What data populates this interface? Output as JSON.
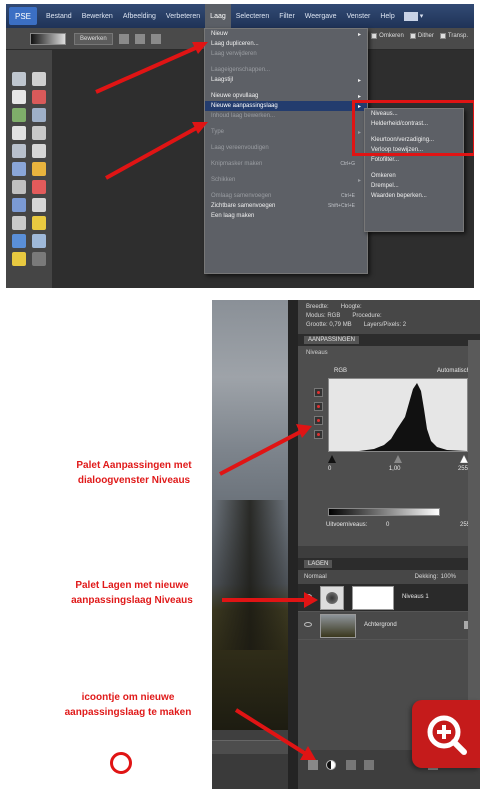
{
  "top_screenshot": {
    "menubar": {
      "logo": "PSE",
      "items": [
        "Bestand",
        "Bewerken",
        "Afbeelding",
        "Verbeteren",
        "Laag",
        "Selecteren",
        "Filter",
        "Weergave",
        "Venster",
        "Help"
      ],
      "active_item": "Laag"
    },
    "options_bar": {
      "button_label": "Bewerken",
      "checkboxes": [
        "Omkeren",
        "Dither",
        "Transp."
      ]
    },
    "layer_menu": [
      {
        "label": "Nieuw",
        "dim": false,
        "arrow": true
      },
      {
        "label": "Laag dupliceren...",
        "dim": false
      },
      {
        "label": "Laag verwijderen",
        "dim": true
      },
      {
        "sep": true
      },
      {
        "label": "Laageigenschappen...",
        "dim": true
      },
      {
        "label": "Laagstijl",
        "dim": false,
        "arrow": true
      },
      {
        "sep": true
      },
      {
        "label": "Nieuwe opvullaag",
        "dim": false,
        "arrow": true
      },
      {
        "label": "Nieuwe aanpassingslaag",
        "highlight": true,
        "arrow": true
      },
      {
        "label": "Inhoud laag bewerken...",
        "dim": true
      },
      {
        "sep": true
      },
      {
        "label": "Type",
        "dim": true,
        "arrow": true
      },
      {
        "sep": true
      },
      {
        "label": "Laag vereenvoudigen",
        "dim": true
      },
      {
        "sep": true
      },
      {
        "label": "Knipmasker maken",
        "dim": true,
        "shortcut": "Ctrl+G"
      },
      {
        "sep": true
      },
      {
        "label": "Schikken",
        "dim": true,
        "arrow": true
      },
      {
        "sep": true
      },
      {
        "label": "Omlaag samenvoegen",
        "dim": true,
        "shortcut": "Ctrl+E"
      },
      {
        "label": "Zichtbare samenvoegen",
        "dim": false,
        "shortcut": "Shift+Ctrl+E"
      },
      {
        "label": "Een laag maken",
        "dim": false
      }
    ],
    "sub_menu": [
      {
        "label": "Niveaus...",
        "highlight": false
      },
      {
        "label": "Helderheid/contrast...",
        "highlight": false
      },
      {
        "label": "Kleurtoon/verzadiging...",
        "highlight": false
      },
      {
        "label": "Verloop toewijzen...",
        "highlight": false
      },
      {
        "label": "Fotofilter...",
        "highlight": false
      },
      {
        "label": "Omkeren",
        "highlight": false
      },
      {
        "label": "Drempel...",
        "highlight": false
      },
      {
        "label": "Waarden beperken...",
        "highlight": false
      }
    ]
  },
  "bottom_screenshot": {
    "info_panel": {
      "row1": [
        "Breedte:",
        "Hoogte:"
      ],
      "row2": [
        "Modus: RGB",
        "Procedure:"
      ],
      "row3": [
        "Grootte: 0,79 MB",
        "Layers/Pixels: 2"
      ]
    },
    "adjustments_panel": {
      "tab_label": "AANPASSINGEN",
      "title": "Niveaus",
      "channel": "RGB",
      "auto_label": "Automatisch",
      "input_values": [
        "0",
        "1,00",
        "255"
      ],
      "output_label": "Uitvoerniveaus:",
      "output_values": [
        "0",
        "255"
      ]
    },
    "layers_panel": {
      "tab_label": "LAGEN",
      "blend_mode": "Normaal",
      "opacity_label": "Dekking:",
      "opacity_value": "100%",
      "layers": [
        {
          "name": "Niveaus 1",
          "type": "adjustment",
          "selected": true
        },
        {
          "name": "Achtergrond",
          "type": "photo",
          "selected": false
        }
      ]
    }
  },
  "callouts": {
    "adjustments": [
      "Palet Aanpassingen met",
      "dialoogvenster Niveaus"
    ],
    "layers": [
      "Palet Lagen met nieuwe",
      "aanpassingslaag Niveaus"
    ],
    "icon": [
      "icoontje om nieuwe",
      "aanpassingslaag te maken"
    ]
  },
  "colors": {
    "annotation_red": "#e01414",
    "menu_highlight": "#233c6e",
    "badge_red": "#c51b1b"
  },
  "icons": {
    "zoom_badge": "zoom-in-plus-icon"
  }
}
